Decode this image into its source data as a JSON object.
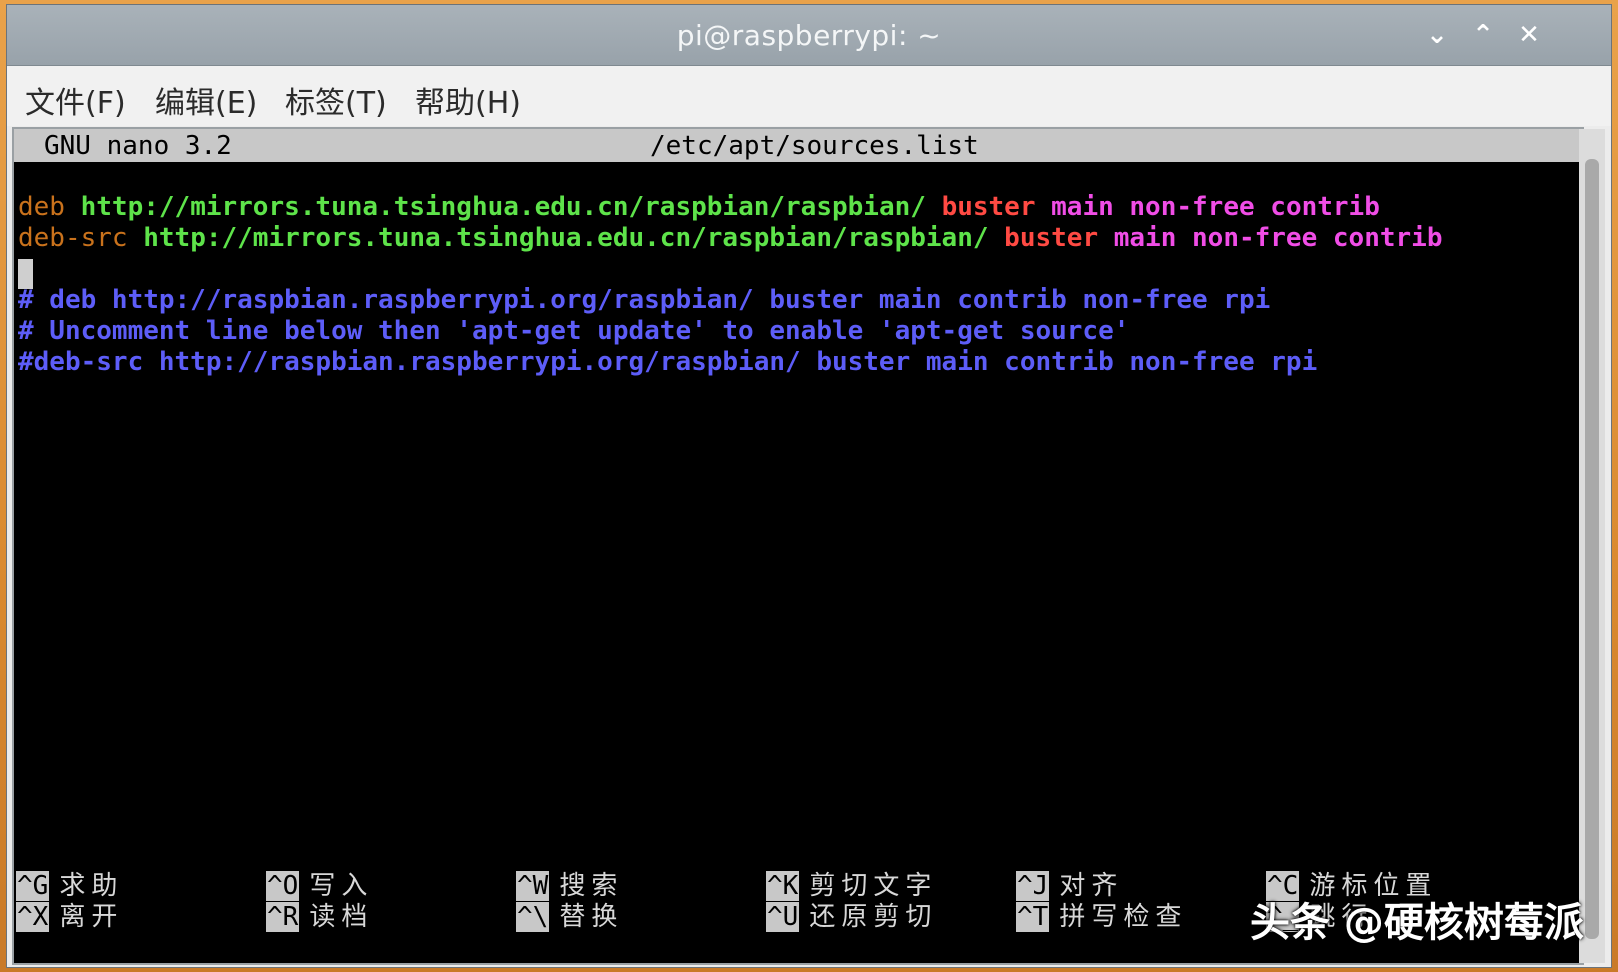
{
  "window": {
    "title": "pi@raspberrypi: ~",
    "buttons": {
      "minimize": "⌄",
      "maximize": "⌃",
      "close": "✕"
    }
  },
  "menu": [
    {
      "label": "文件(F)"
    },
    {
      "label": "编辑(E)"
    },
    {
      "label": "标签(T)"
    },
    {
      "label": "帮助(H)"
    }
  ],
  "nano": {
    "version": "GNU nano 3.2",
    "filename": "/etc/apt/sources.list",
    "lines": {
      "l1_keyword": "deb",
      "l1_url": "http://mirrors.tuna.tsinghua.edu.cn/raspbian/raspbian/",
      "l1_dist": "buster",
      "l1_components": "main non-free contrib",
      "l2_keyword": "deb-src",
      "l2_url": "http://mirrors.tuna.tsinghua.edu.cn/raspbian/raspbian/",
      "l2_dist": "buster",
      "l2_components": "main non-free contrib",
      "c1": "# deb http://raspbian.raspberrypi.org/raspbian/ buster main contrib non-free rpi",
      "c2": "# Uncomment line below then 'apt-get update' to enable 'apt-get source'",
      "c3": "#deb-src http://raspbian.raspberrypi.org/raspbian/ buster main contrib non-free rpi"
    },
    "shortcuts": [
      {
        "key": "^G",
        "label": "求助"
      },
      {
        "key": "^X",
        "label": "离开"
      },
      {
        "key": "^O",
        "label": "写入"
      },
      {
        "key": "^R",
        "label": "读档"
      },
      {
        "key": "^W",
        "label": "搜索"
      },
      {
        "key": "^\\",
        "label": "替换"
      },
      {
        "key": "^K",
        "label": "剪切文字"
      },
      {
        "key": "^U",
        "label": "还原剪切"
      },
      {
        "key": "^J",
        "label": "对齐"
      },
      {
        "key": "^T",
        "label": "拼写检查"
      },
      {
        "key": "^C",
        "label": "游标位置"
      },
      {
        "key": "^_",
        "label": "跳行"
      }
    ]
  },
  "watermark": "头条 @硬核树莓派"
}
